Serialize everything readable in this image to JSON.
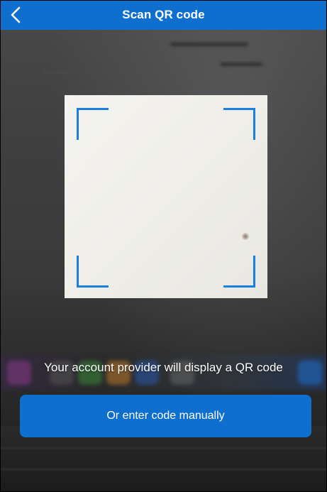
{
  "header": {
    "title": "Scan QR code",
    "back_icon": "chevron-left-icon",
    "color": "#0f6fcf"
  },
  "scanner": {
    "corner_color": "#1a7fe0"
  },
  "instruction": {
    "text": "Your account provider will display a QR code"
  },
  "manual_button": {
    "label": "Or enter code manually",
    "color": "#0f6fcf"
  }
}
